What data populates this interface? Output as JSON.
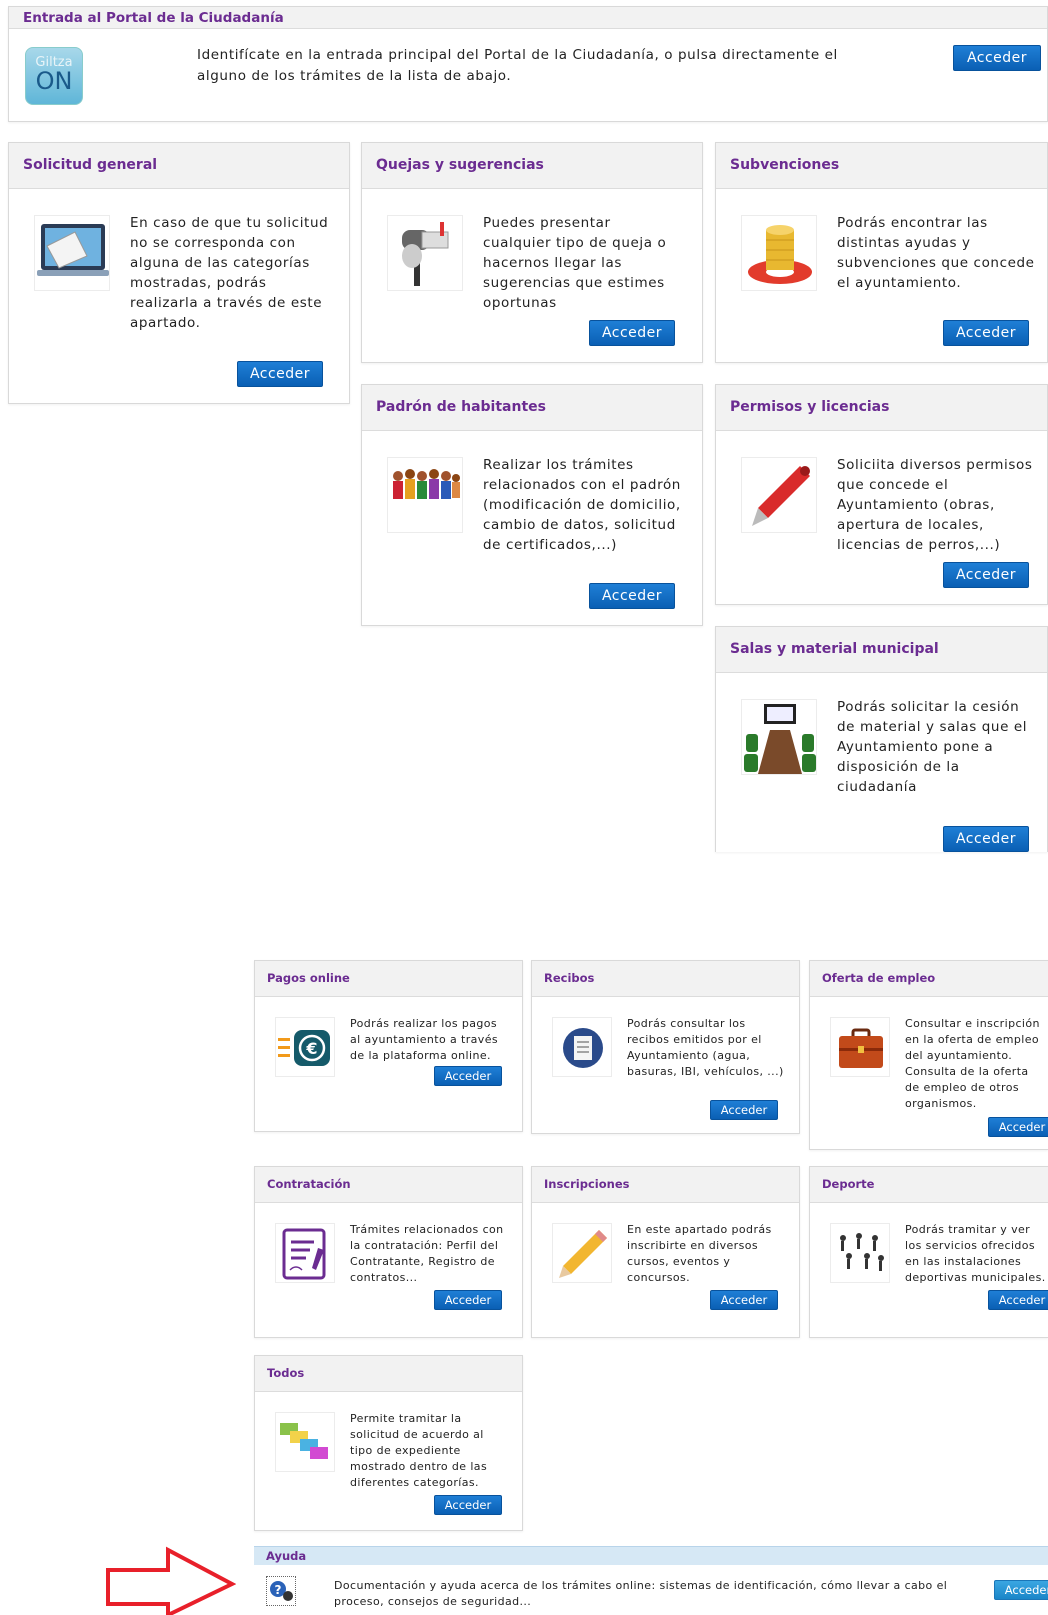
{
  "portal": {
    "title": "Entrada al Portal de la Ciudadanía",
    "logo_top": "Giltza",
    "logo_bottom": "ON",
    "description": "Identifícate en la entrada principal del Portal de la Ciudadanía, o pulsa directamente el alguno de los trámites de la lista de abajo.",
    "button": "Acceder"
  },
  "cards_large": [
    {
      "title": "Solicitud general",
      "text": "En caso de que tu solicitud no se corresponda con alguna de las categorías mostradas, podrás realizarla a través de este apartado.",
      "button": "Acceder"
    },
    {
      "title": "Quejas y sugerencias",
      "text": "Puedes presentar cualquier tipo de queja o hacernos llegar las sugerencias que estimes oportunas",
      "button": "Acceder"
    },
    {
      "title": "Subvenciones",
      "text": "Podrás encontrar las distintas ayudas y subvenciones que concede el ayuntamiento.",
      "button": "Acceder"
    },
    {
      "title": "Padrón de habitantes",
      "text": "Realizar los trámites relacionados con el padrón (modificación de domicilio, cambio de datos, solicitud de certificados,...)",
      "button": "Acceder"
    },
    {
      "title": "Permisos y licencias",
      "text": "Soliciita diversos permisos que concede el Ayuntamiento (obras, apertura de locales, licencias de perros,...)",
      "button": "Acceder"
    },
    {
      "title": "Salas y material municipal",
      "text": "Podrás solicitar la cesión de material y salas que el Ayuntamiento pone a disposición de la ciudadanía",
      "button": "Acceder"
    }
  ],
  "cards_small": [
    {
      "title": "Pagos online",
      "text": "Podrás realizar los pagos al ayuntamiento a través de la plataforma online.",
      "button": "Acceder"
    },
    {
      "title": "Recibos",
      "text": "Podrás consultar los recibos emitidos por el Ayuntamiento (agua, basuras, IBI, vehículos, ...)",
      "button": "Acceder"
    },
    {
      "title": "Oferta de empleo",
      "text": "Consultar e inscripción en la oferta de empleo del ayuntamiento. Consulta de la oferta de empleo de otros organismos.",
      "button": "Acceder"
    },
    {
      "title": "Contratación",
      "text": "Trámites relacionados con la contratación: Perfil del Contratante, Registro de contratos...",
      "button": "Acceder"
    },
    {
      "title": "Inscripciones",
      "text": "En este apartado podrás inscribirte en diversos cursos, eventos y concursos.",
      "button": "Acceder"
    },
    {
      "title": "Deporte",
      "text": "Podrás tramitar y ver los servicios ofrecidos en las instalaciones deportivas municipales.",
      "button": "Acceder"
    },
    {
      "title": "Todos",
      "text": "Permite tramitar la solicitud de acuerdo al tipo de expediente mostrado dentro de las diferentes categorías.",
      "button": "Acceder"
    }
  ],
  "help": {
    "title": "Ayuda",
    "text": "Documentación y ayuda acerca de los trámites online: sistemas de identificación, cómo llevar a cabo el proceso, consejos de seguridad...",
    "button": "Acceder"
  },
  "colors": {
    "title_purple": "#6b2c91",
    "button_blue": "#0a5fb4",
    "help_header": "#d6e8f5",
    "arrow_red": "#e8202a"
  }
}
